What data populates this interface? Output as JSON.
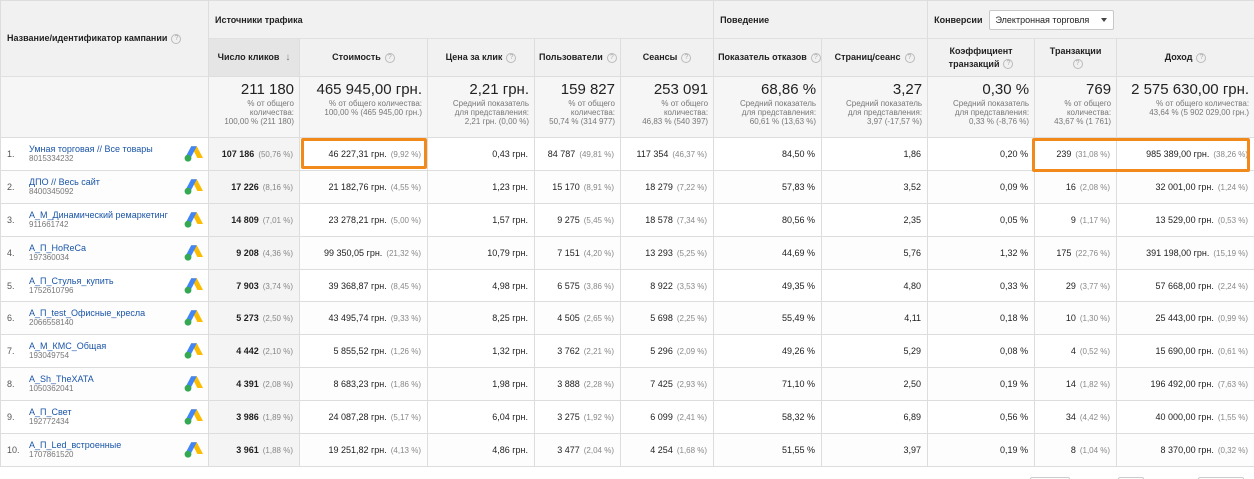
{
  "header": {
    "campaign_col": "Название/идентификатор кампании",
    "group_traffic": "Источники трафика",
    "group_behavior": "Поведение",
    "group_conversions": "Конверсии",
    "conversion_select": "Электронная торговля"
  },
  "columns": {
    "clicks": "Число кликов",
    "cost": "Стоимость",
    "cpc": "Цена за клик",
    "users": "Пользователи",
    "sessions": "Сеансы",
    "bounce": "Показатель отказов",
    "pages": "Страниц/сеанс",
    "conv_line1": "Коэффициент",
    "conv_line2": "транзакций",
    "transactions": "Транзакции",
    "revenue": "Доход"
  },
  "summary": {
    "clicks": {
      "value": "211 180",
      "note1": "% от общего",
      "note2": "количества:",
      "note3": "100,00 % (211 180)"
    },
    "cost": {
      "value": "465 945,00 грн.",
      "note1": "% от общего количества:",
      "note2": "100,00 % (465 945,00 грн.)",
      "note3": ""
    },
    "cpc": {
      "value": "2,21 грн.",
      "note1": "Средний показатель",
      "note2": "для представления:",
      "note3": "2,21 грн. (0,00 %)"
    },
    "users": {
      "value": "159 827",
      "note1": "% от общего",
      "note2": "количества:",
      "note3": "50,74 % (314 977)"
    },
    "sessions": {
      "value": "253 091",
      "note1": "% от общего",
      "note2": "количества:",
      "note3": "46,83 % (540 397)"
    },
    "bounce": {
      "value": "68,86 %",
      "note1": "Средний показатель",
      "note2": "для представления:",
      "note3": "60,61 % (13,63 %)"
    },
    "pages": {
      "value": "3,27",
      "note1": "Средний показатель",
      "note2": "для представления:",
      "note3": "3,97 (-17,57 %)"
    },
    "conv": {
      "value": "0,30 %",
      "note1": "Средний показатель",
      "note2": "для представления:",
      "note3": "0,33 % (-8,76 %)"
    },
    "transactions": {
      "value": "769",
      "note1": "% от общего",
      "note2": "количества:",
      "note3": "43,67 % (1 761)"
    },
    "revenue": {
      "value": "2 575 630,00 грн.",
      "note1": "% от общего количества:",
      "note2": "43,64 % (5 902 029,00 грн.)",
      "note3": ""
    }
  },
  "rows": [
    {
      "num": "1.",
      "name": "Умная торговая // Все товары",
      "id": "8015334232",
      "clicks": "107 186",
      "clicks_pct": "(50,76 %)",
      "cost": "46 227,31 грн.",
      "cost_pct": "(9,92 %)",
      "cpc": "0,43 грн.",
      "users": "84 787",
      "users_pct": "(49,81 %)",
      "sessions": "117 354",
      "sessions_pct": "(46,37 %)",
      "bounce": "84,50 %",
      "pages": "1,86",
      "conv": "0,20 %",
      "trans": "239",
      "trans_pct": "(31,08 %)",
      "rev": "985 389,00 грн.",
      "rev_pct": "(38,26 %)"
    },
    {
      "num": "2.",
      "name": "ДПО // Весь сайт",
      "id": "8400345092",
      "clicks": "17 226",
      "clicks_pct": "(8,16 %)",
      "cost": "21 182,76 грн.",
      "cost_pct": "(4,55 %)",
      "cpc": "1,23 грн.",
      "users": "15 170",
      "users_pct": "(8,91 %)",
      "sessions": "18 279",
      "sessions_pct": "(7,22 %)",
      "bounce": "57,83 %",
      "pages": "3,52",
      "conv": "0,09 %",
      "trans": "16",
      "trans_pct": "(2,08 %)",
      "rev": "32 001,00 грн.",
      "rev_pct": "(1,24 %)"
    },
    {
      "num": "3.",
      "name": "А_М_Динамический ремаркетинг",
      "id": "911661742",
      "clicks": "14 809",
      "clicks_pct": "(7,01 %)",
      "cost": "23 278,21 грн.",
      "cost_pct": "(5,00 %)",
      "cpc": "1,57 грн.",
      "users": "9 275",
      "users_pct": "(5,45 %)",
      "sessions": "18 578",
      "sessions_pct": "(7,34 %)",
      "bounce": "80,56 %",
      "pages": "2,35",
      "conv": "0,05 %",
      "trans": "9",
      "trans_pct": "(1,17 %)",
      "rev": "13 529,00 грн.",
      "rev_pct": "(0,53 %)"
    },
    {
      "num": "4.",
      "name": "А_П_HoReCa",
      "id": "197360034",
      "clicks": "9 208",
      "clicks_pct": "(4,36 %)",
      "cost": "99 350,05 грн.",
      "cost_pct": "(21,32 %)",
      "cpc": "10,79 грн.",
      "users": "7 151",
      "users_pct": "(4,20 %)",
      "sessions": "13 293",
      "sessions_pct": "(5,25 %)",
      "bounce": "44,69 %",
      "pages": "5,76",
      "conv": "1,32 %",
      "trans": "175",
      "trans_pct": "(22,76 %)",
      "rev": "391 198,00 грн.",
      "rev_pct": "(15,19 %)"
    },
    {
      "num": "5.",
      "name": "А_П_Стулья_купить",
      "id": "1752610796",
      "clicks": "7 903",
      "clicks_pct": "(3,74 %)",
      "cost": "39 368,87 грн.",
      "cost_pct": "(8,45 %)",
      "cpc": "4,98 грн.",
      "users": "6 575",
      "users_pct": "(3,86 %)",
      "sessions": "8 922",
      "sessions_pct": "(3,53 %)",
      "bounce": "49,35 %",
      "pages": "4,80",
      "conv": "0,33 %",
      "trans": "29",
      "trans_pct": "(3,77 %)",
      "rev": "57 668,00 грн.",
      "rev_pct": "(2,24 %)"
    },
    {
      "num": "6.",
      "name": "А_П_test_Офисные_кресла",
      "id": "2066558140",
      "clicks": "5 273",
      "clicks_pct": "(2,50 %)",
      "cost": "43 495,74 грн.",
      "cost_pct": "(9,33 %)",
      "cpc": "8,25 грн.",
      "users": "4 505",
      "users_pct": "(2,65 %)",
      "sessions": "5 698",
      "sessions_pct": "(2,25 %)",
      "bounce": "55,49 %",
      "pages": "4,11",
      "conv": "0,18 %",
      "trans": "10",
      "trans_pct": "(1,30 %)",
      "rev": "25 443,00 грн.",
      "rev_pct": "(0,99 %)"
    },
    {
      "num": "7.",
      "name": "А_М_КМС_Общая",
      "id": "193049754",
      "clicks": "4 442",
      "clicks_pct": "(2,10 %)",
      "cost": "5 855,52 грн.",
      "cost_pct": "(1,26 %)",
      "cpc": "1,32 грн.",
      "users": "3 762",
      "users_pct": "(2,21 %)",
      "sessions": "5 296",
      "sessions_pct": "(2,09 %)",
      "bounce": "49,26 %",
      "pages": "5,29",
      "conv": "0,08 %",
      "trans": "4",
      "trans_pct": "(0,52 %)",
      "rev": "15 690,00 грн.",
      "rev_pct": "(0,61 %)"
    },
    {
      "num": "8.",
      "name": "А_Sh_TheXATA",
      "id": "1050362041",
      "clicks": "4 391",
      "clicks_pct": "(2,08 %)",
      "cost": "8 683,23 грн.",
      "cost_pct": "(1,86 %)",
      "cpc": "1,98 грн.",
      "users": "3 888",
      "users_pct": "(2,28 %)",
      "sessions": "7 425",
      "sessions_pct": "(2,93 %)",
      "bounce": "71,10 %",
      "pages": "2,50",
      "conv": "0,19 %",
      "trans": "14",
      "trans_pct": "(1,82 %)",
      "rev": "196 492,00 грн.",
      "rev_pct": "(7,63 %)"
    },
    {
      "num": "9.",
      "name": "А_П_Свет",
      "id": "192772434",
      "clicks": "3 986",
      "clicks_pct": "(1,89 %)",
      "cost": "24 087,28 грн.",
      "cost_pct": "(5,17 %)",
      "cpc": "6,04 грн.",
      "users": "3 275",
      "users_pct": "(1,92 %)",
      "sessions": "6 099",
      "sessions_pct": "(2,41 %)",
      "bounce": "58,32 %",
      "pages": "6,89",
      "conv": "0,56 %",
      "trans": "34",
      "trans_pct": "(4,42 %)",
      "rev": "40 000,00 грн.",
      "rev_pct": "(1,55 %)"
    },
    {
      "num": "10.",
      "name": "А_П_Led_встроенные",
      "id": "1707861520",
      "clicks": "3 961",
      "clicks_pct": "(1,88 %)",
      "cost": "19 251,82 грн.",
      "cost_pct": "(4,13 %)",
      "cpc": "4,86 грн.",
      "users": "3 477",
      "users_pct": "(2,04 %)",
      "sessions": "4 254",
      "sessions_pct": "(1,68 %)",
      "bounce": "51,55 %",
      "pages": "3,97",
      "conv": "0,19 %",
      "trans": "8",
      "trans_pct": "(1,04 %)",
      "rev": "8 370,00 грн.",
      "rev_pct": "(0,32 %)"
    }
  ],
  "highlight_color": "#f28a1b",
  "link_color": "#1a55a8"
}
